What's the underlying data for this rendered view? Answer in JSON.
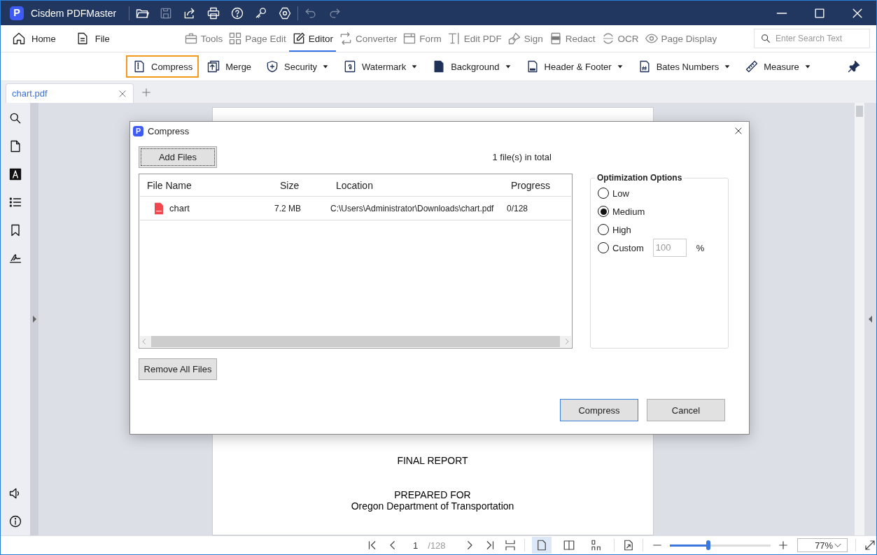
{
  "app": {
    "logo": "P",
    "title": "Cisdem PDFMaster"
  },
  "menu": [
    {
      "label": "Home"
    },
    {
      "label": "File"
    }
  ],
  "tool_tabs": [
    {
      "label": "Tools",
      "selected": false
    },
    {
      "label": "Page Edit",
      "selected": false
    },
    {
      "label": "Editor",
      "selected": true
    },
    {
      "label": "Converter",
      "selected": false
    },
    {
      "label": "Form",
      "selected": false
    },
    {
      "label": "Edit PDF",
      "selected": false
    },
    {
      "label": "Sign",
      "selected": false
    },
    {
      "label": "Redact",
      "selected": false
    },
    {
      "label": "OCR",
      "selected": false
    },
    {
      "label": "Page Display",
      "selected": false
    }
  ],
  "search": {
    "placeholder": "Enter Search Text"
  },
  "ribbon": [
    {
      "label": "Compress",
      "selected": true,
      "dropdown": false
    },
    {
      "label": "Merge",
      "selected": false,
      "dropdown": false
    },
    {
      "label": "Security",
      "selected": false,
      "dropdown": true
    },
    {
      "label": "Watermark",
      "selected": false,
      "dropdown": true
    },
    {
      "label": "Background",
      "selected": false,
      "dropdown": true
    },
    {
      "label": "Header & Footer",
      "selected": false,
      "dropdown": true
    },
    {
      "label": "Bates Numbers",
      "selected": false,
      "dropdown": true
    },
    {
      "label": "Measure",
      "selected": false,
      "dropdown": true
    }
  ],
  "doc_tabs": [
    {
      "label": "chart.pdf",
      "selected": true
    }
  ],
  "page": {
    "blocks": [
      {
        "lines": [
          "FINAL REPORT"
        ]
      },
      {
        "lines": [
          "PREPARED FOR",
          "Oregon Department of Transportation"
        ]
      }
    ]
  },
  "status_bar": {
    "page": "1",
    "total": "/128",
    "view_modes": [
      {
        "selected": true
      },
      {
        "selected": false
      },
      {
        "selected": false
      }
    ],
    "zoom_slider": {
      "level": 0.38
    },
    "zoom": "77%"
  },
  "dialog": {
    "logo": "P",
    "title": "Compress",
    "add_button": "Add Files",
    "count": "1 file(s) in total",
    "columns": [
      "File Name",
      "Size",
      "Location",
      "Progress"
    ],
    "rows": [
      {
        "name": "chart",
        "size": "7.2 MB",
        "location": "C:\\Users\\Administrator\\Downloads\\chart.pdf",
        "progress": "0/128"
      }
    ],
    "remove_button": "Remove All Files",
    "options": {
      "title": "Optimization Options",
      "choices": [
        {
          "label": "Low",
          "selected": false,
          "kind": "plain"
        },
        {
          "label": "Medium",
          "selected": true,
          "kind": "plain"
        },
        {
          "label": "High",
          "selected": false,
          "kind": "plain"
        },
        {
          "label": "Custom",
          "selected": false,
          "kind": "custom"
        }
      ],
      "custom_value": "100",
      "unit": "%"
    },
    "buttons": [
      {
        "label": "Compress",
        "default": true
      },
      {
        "label": "Cancel",
        "default": false
      }
    ]
  }
}
